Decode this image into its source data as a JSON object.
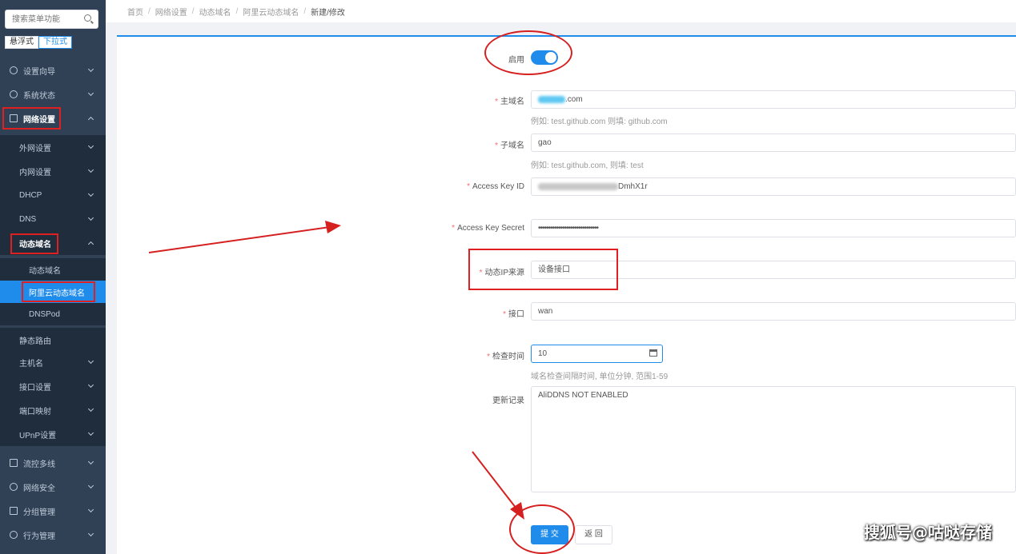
{
  "sidebar": {
    "search_placeholder": "搜索菜单功能",
    "mode_float": "悬浮式",
    "mode_dropdown": "下拉式",
    "items": [
      {
        "label": "设置向导"
      },
      {
        "label": "系统状态"
      },
      {
        "label": "网络设置"
      },
      {
        "label": "外网设置"
      },
      {
        "label": "内网设置"
      },
      {
        "label": "DHCP"
      },
      {
        "label": "DNS"
      },
      {
        "label": "动态域名"
      },
      {
        "label": "动态域名"
      },
      {
        "label": "阿里云动态域名"
      },
      {
        "label": "DNSPod"
      },
      {
        "label": "静态路由"
      },
      {
        "label": "主机名"
      },
      {
        "label": "接口设置"
      },
      {
        "label": "端口映射"
      },
      {
        "label": "UPnP设置"
      },
      {
        "label": "流控多线"
      },
      {
        "label": "网络安全"
      },
      {
        "label": "分组管理"
      },
      {
        "label": "行为管理"
      }
    ]
  },
  "breadcrumb": [
    "首页",
    "网络设置",
    "动态域名",
    "阿里云动态域名",
    "新建/修改"
  ],
  "form": {
    "enable_label": "启用",
    "domain_label": "主域名",
    "domain_value_suffix": ".com",
    "domain_hint": "例如: test.github.com 则填: github.com",
    "subdomain_label": "子域名",
    "subdomain_value": "gao",
    "subdomain_hint": "例如: test.github.com, 则填: test",
    "akid_label": "Access Key ID",
    "akid_value_suffix": "DmhX1r",
    "aksecret_label": "Access Key Secret",
    "aksecret_value": "••••••••••••••••••••••••••••••",
    "ip_source_label": "动态IP来源",
    "ip_source_value": "设备接口",
    "iface_label": "接口",
    "iface_value": "wan",
    "interval_label": "检查时间",
    "interval_value": "10",
    "interval_hint": "域名检查间隔时间, 单位分钟, 范围1-59",
    "log_label": "更新记录",
    "log_value": "AliDDNS NOT ENABLED",
    "submit_label": "提 交",
    "back_label": "返 回"
  },
  "watermark": "搜狐号@咕哒存储",
  "colors": {
    "accent": "#1f8ceb",
    "sidebar": "#304156",
    "annotation": "#d62020"
  }
}
